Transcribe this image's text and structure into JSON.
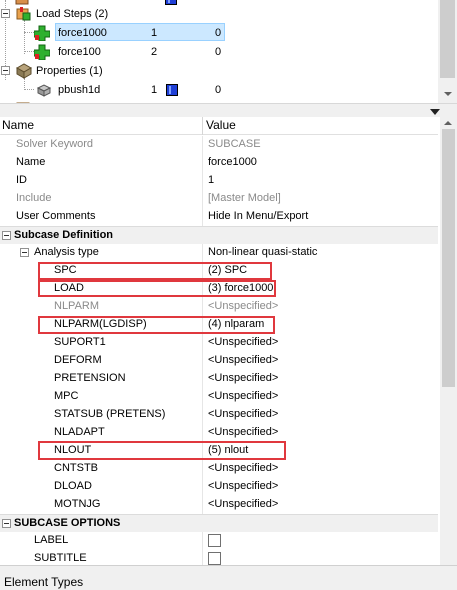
{
  "tree": {
    "load_steps": {
      "label": "Load Steps (2)"
    },
    "items": [
      {
        "label": "force1000",
        "col1": "1",
        "col2": "0"
      },
      {
        "label": "force100",
        "col1": "2",
        "col2": "0"
      }
    ],
    "properties": {
      "label": "Properties (1)"
    },
    "pbush": {
      "label": "pbush1d",
      "col1": "1",
      "col2": "0"
    }
  },
  "grid": {
    "header": {
      "name": "Name",
      "value": "Value"
    },
    "general": [
      {
        "name": "Solver Keyword",
        "value": "SUBCASE",
        "muted": true
      },
      {
        "name": "Name",
        "value": "force1000"
      },
      {
        "name": "ID",
        "value": "1"
      },
      {
        "name": "Include",
        "value": "[Master Model]",
        "muted": true
      },
      {
        "name": "User Comments",
        "value": "Hide In Menu/Export"
      }
    ],
    "subcase_definition": {
      "label": "Subcase Definition"
    },
    "analysis_type": {
      "name": "Analysis type",
      "value": "Non-linear quasi-static"
    },
    "params": [
      {
        "name": "SPC",
        "value": "(2) SPC"
      },
      {
        "name": "LOAD",
        "value": "(3) force1000"
      },
      {
        "name": "NLPARM",
        "value": "<Unspecified>",
        "muted": true
      },
      {
        "name": "NLPARM(LGDISP)",
        "value": "(4) nlparam"
      },
      {
        "name": "SUPORT1",
        "value": "<Unspecified>"
      },
      {
        "name": "DEFORM",
        "value": "<Unspecified>"
      },
      {
        "name": "PRETENSION",
        "value": "<Unspecified>"
      },
      {
        "name": "MPC",
        "value": "<Unspecified>"
      },
      {
        "name": "STATSUB (PRETENS)",
        "value": "<Unspecified>"
      },
      {
        "name": "NLADAPT",
        "value": "<Unspecified>"
      },
      {
        "name": "NLOUT",
        "value": "(5) nlout"
      },
      {
        "name": "CNTSTB",
        "value": "<Unspecified>"
      },
      {
        "name": "DLOAD",
        "value": "<Unspecified>"
      },
      {
        "name": "MOTNJG",
        "value": "<Unspecified>"
      }
    ],
    "subcase_options": {
      "label": "SUBCASE OPTIONS"
    },
    "options": [
      {
        "name": "LABEL"
      },
      {
        "name": "SUBTITLE"
      }
    ]
  },
  "bottom": {
    "label": "Element Types"
  },
  "colors": {
    "highlight": "#e0383e",
    "selection": "#cce8ff",
    "section_bg": "#f0f0f0"
  },
  "icons": {
    "load_steps": "load-steps-icon",
    "load_step": "green-cross-icon",
    "properties": "properties-icon",
    "property": "property-icon"
  }
}
